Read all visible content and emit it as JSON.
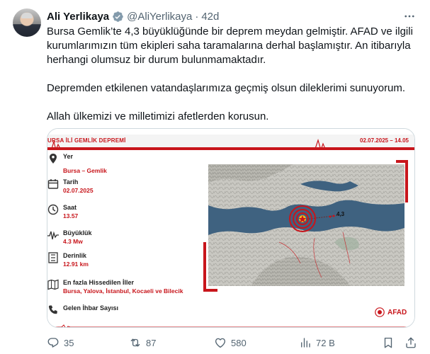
{
  "author": {
    "name": "Ali Yerlikaya",
    "handle": "@AliYerlikaya",
    "separator": "·",
    "time": "42d"
  },
  "tweet": {
    "paragraphs": [
      "Bursa Gemlik’te 4,3 büyüklüğünde bir deprem meydan gelmiştir. AFAD ve ilgili kurumlarımızın tüm ekipleri saha taramalarına derhal başlamıştır. An itibarıyla herhangi olumsuz bir durum bulunmamaktadır.",
      "Depremden etkilenen vatandaşlarımıza geçmiş olsun dileklerimi sunuyorum.",
      "Allah ülkemizi ve milletimizi afetlerden korusun."
    ]
  },
  "infographic": {
    "title": "BURSA İLİ GEMLİK DEPREMİ",
    "title_visible": "URSA İLİ GEMLİK DEPREMİ",
    "datetime": "02.07.2025 – 14.05",
    "rows": [
      {
        "label": "Yer",
        "value": "Bursa – Gemlik",
        "icon": "location-pin-icon"
      },
      {
        "label": "Tarih",
        "value": "02.07.2025",
        "icon": "calendar-icon"
      },
      {
        "label": "Saat",
        "value": "13.57",
        "icon": "clock-icon"
      },
      {
        "label": "Büyüklük",
        "value": "4.3 Mw",
        "icon": "seismograph-icon"
      },
      {
        "label": "Derinlik",
        "value": "12.91 km",
        "icon": "depth-icon"
      },
      {
        "label": "En fazla Hissedilen İller",
        "value": "Bursa, Yalova, İstanbul, Kocaeli ve Bilecik",
        "icon": "map-icon"
      },
      {
        "label": "Gelen İhbar Sayısı",
        "value": "",
        "icon": "phone-icon"
      }
    ],
    "magnitude_marker": "4,3",
    "agency": "AFAD",
    "accent": "#c8151b"
  },
  "actions": {
    "replies": "35",
    "reposts": "87",
    "likes": "580",
    "views": "72 B"
  },
  "colors": {
    "text": "#0f1419",
    "muted": "#536471",
    "verified": "#829aab",
    "border": "#cfd9de"
  }
}
